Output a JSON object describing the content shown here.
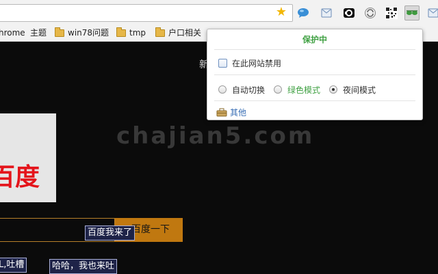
{
  "toolbar": {
    "extensions": [
      "chat-bubble-icon",
      "mail-icon",
      "sync-icon",
      "refresh-icon",
      "qr-code-icon",
      "sunglasses-icon",
      "mail-icon"
    ]
  },
  "bookmarks": [
    {
      "label": "hrome",
      "folder": false
    },
    {
      "label": "主题",
      "folder": false
    },
    {
      "label": "win78问题",
      "folder": true
    },
    {
      "label": "tmp",
      "folder": true
    },
    {
      "label": "户口相关",
      "folder": true
    }
  ],
  "page": {
    "partial_char": "新",
    "logo_text": "百度",
    "search_button": "百度一下",
    "danmu": [
      "百度我来了",
      "L,吐槽",
      "哈哈，我也来吐"
    ],
    "watermark": "chajian5.com"
  },
  "popup": {
    "title": "保护中",
    "disable_label": "在此网站禁用",
    "modes": [
      {
        "label": "自动切换",
        "checked": false,
        "color": "#333333"
      },
      {
        "label": "绿色模式",
        "checked": false,
        "color": "#41a144"
      },
      {
        "label": "夜间模式",
        "checked": true,
        "color": "#333333"
      }
    ],
    "other_label": "其他"
  },
  "colors": {
    "accent_green": "#41a144",
    "search_button": "#c07810",
    "page_bg": "#0b0b0b",
    "logo_red": "#e4141b"
  }
}
